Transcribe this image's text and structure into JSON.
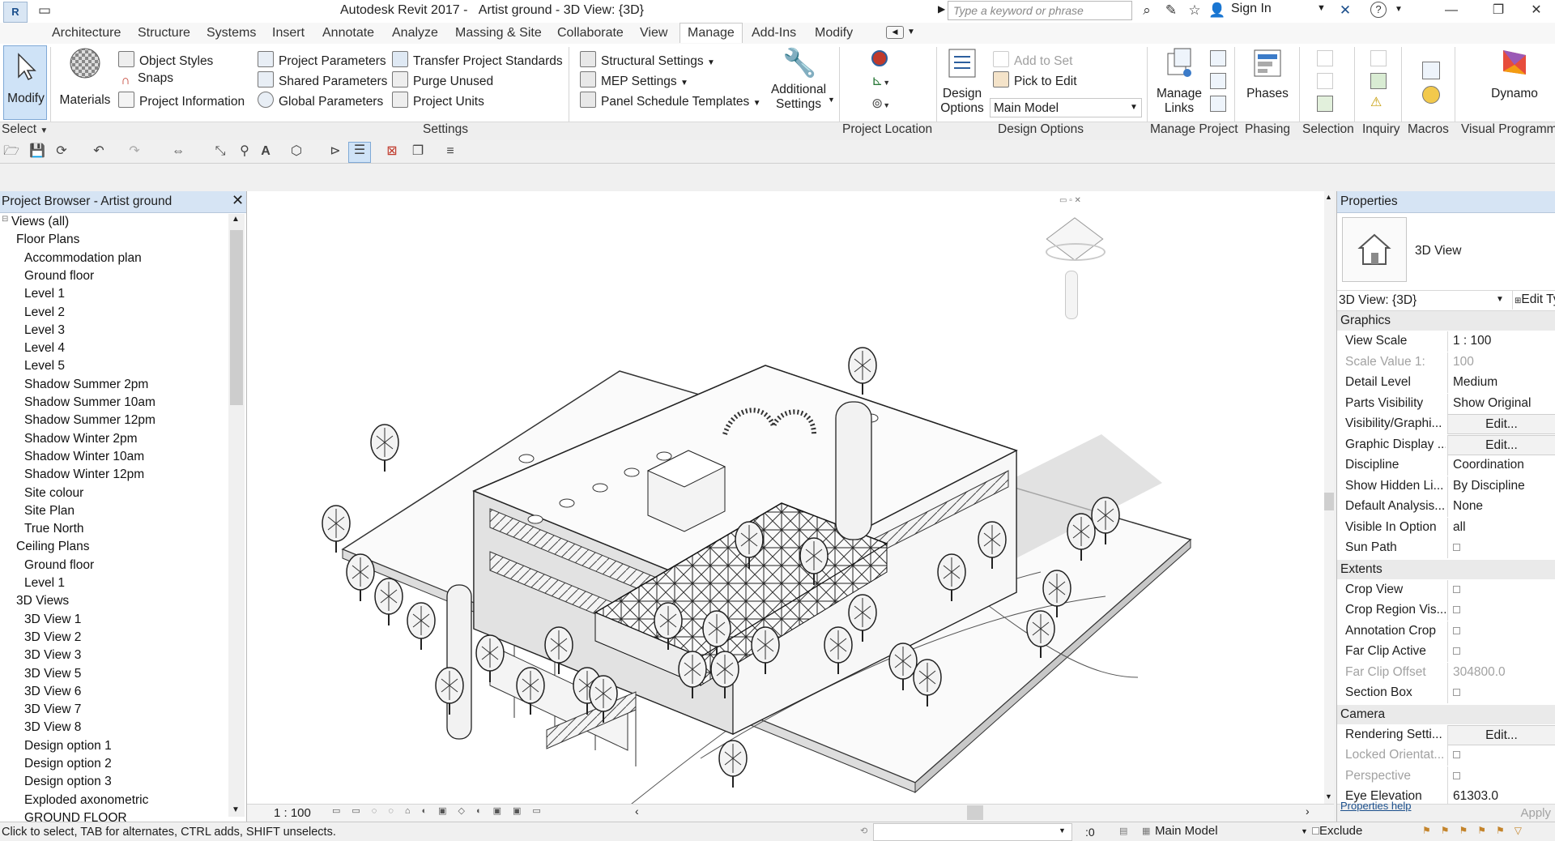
{
  "titlebar": {
    "app_logo": "R",
    "app_title": "Autodesk Revit 2017 -",
    "document_title": "Artist ground - 3D View: {3D}",
    "search_placeholder": "Type a keyword or phrase",
    "sign_in": "Sign In"
  },
  "tabs": [
    "Architecture",
    "Structure",
    "Systems",
    "Insert",
    "Annotate",
    "Analyze",
    "Massing & Site",
    "Collaborate",
    "View",
    "Manage",
    "Add-Ins",
    "Modify"
  ],
  "active_tab": "Manage",
  "ribbon": {
    "modify": "Modify",
    "select": "Select",
    "materials": "Materials",
    "object_styles": "Object  Styles",
    "snaps": "Snaps",
    "project_information": "Project  Information",
    "project_parameters": "Project  Parameters",
    "shared_parameters": "Shared  Parameters",
    "global_parameters": "Global  Parameters",
    "transfer_project_standards": "Transfer  Project Standards",
    "purge_unused": "Purge  Unused",
    "project_units": "Project  Units",
    "structural_settings": "Structural  Settings",
    "mep_settings": "MEP  Settings",
    "panel_schedule_templates": "Panel Schedule  Templates",
    "additional_settings_1": "Additional",
    "additional_settings_2": "Settings",
    "design_options_1": "Design",
    "design_options_2": "Options",
    "add_to_set": "Add to Set",
    "pick_to_edit": "Pick to Edit",
    "main_model": "Main Model",
    "manage_links_1": "Manage",
    "manage_links_2": "Links",
    "phases": "Phases",
    "dynamo": "Dynamo",
    "panels": {
      "settings": "Settings",
      "project_location": "Project Location",
      "design_options": "Design Options",
      "manage_project": "Manage Project",
      "phasing": "Phasing",
      "selection": "Selection",
      "inquiry": "Inquiry",
      "macros": "Macros",
      "visual_programming": "Visual Programmi"
    }
  },
  "project_browser": {
    "title": "Project Browser - Artist ground",
    "root": "Views (all)",
    "floor_plans": "Floor Plans",
    "floor_plan_items": [
      "Accommodation plan",
      "Ground floor",
      "Level 1",
      "Level 2",
      "Level 3",
      "Level 4",
      "Level 5",
      "Shadow Summer 2pm",
      "Shadow Summer 10am",
      "Shadow Summer 12pm",
      "Shadow Winter 2pm",
      "Shadow Winter 10am",
      "Shadow Winter 12pm",
      "Site colour",
      "Site Plan",
      "True North"
    ],
    "ceiling_plans": "Ceiling Plans",
    "ceiling_plan_items": [
      "Ground floor",
      "Level 1"
    ],
    "views_3d": "3D Views",
    "views_3d_items": [
      "3D View 1",
      "3D View 2",
      "3D View 3",
      "3D View 5",
      "3D View 6",
      "3D View 7",
      "3D View 8",
      "Design option 1",
      "Design option 2",
      "Design option 3",
      "Exploded axonometric",
      "GROUND FLOOR"
    ]
  },
  "view": {
    "scale": "1 : 100"
  },
  "properties": {
    "title": "Properties",
    "type_name": "3D View",
    "instance_selector": "3D View: {3D}",
    "edit_type": "Edit Ty",
    "sections": {
      "graphics": "Graphics",
      "extents": "Extents",
      "camera": "Camera"
    },
    "graphics_rows": [
      {
        "k": "View Scale",
        "v": "1 : 100"
      },
      {
        "k": "Scale Value    1:",
        "v": "100"
      },
      {
        "k": "Detail Level",
        "v": "Medium"
      },
      {
        "k": "Parts Visibility",
        "v": "Show Original"
      },
      {
        "k": "Visibility/Graphi...",
        "v": "Edit..."
      },
      {
        "k": "Graphic Display ...",
        "v": "Edit..."
      },
      {
        "k": "Discipline",
        "v": "Coordination"
      },
      {
        "k": "Show Hidden Li...",
        "v": "By Discipline"
      },
      {
        "k": "Default Analysis...",
        "v": "None"
      },
      {
        "k": "Visible In Option",
        "v": "all"
      },
      {
        "k": "Sun Path",
        "v": ""
      }
    ],
    "extents_rows": [
      {
        "k": "Crop View",
        "v": ""
      },
      {
        "k": "Crop Region Vis...",
        "v": ""
      },
      {
        "k": "Annotation Crop",
        "v": ""
      },
      {
        "k": "Far Clip Active",
        "v": ""
      },
      {
        "k": "Far Clip Offset",
        "v": "304800.0"
      },
      {
        "k": "Section Box",
        "v": ""
      }
    ],
    "camera_rows": [
      {
        "k": "Rendering Setti...",
        "v": "Edit..."
      },
      {
        "k": "Locked Orientat...",
        "v": ""
      },
      {
        "k": "Perspective",
        "v": ""
      },
      {
        "k": "Eye Elevation",
        "v": "61303.0"
      }
    ],
    "help_link": "Properties help",
    "apply": "Apply"
  },
  "statusbar": {
    "hint": "Click to select, TAB for alternates, CTRL adds, SHIFT unselects.",
    "zero": ":0",
    "main_model": "Main Model",
    "exclude": "Exclude"
  },
  "colors": {
    "accent_blue": "#1b4f8c",
    "panel_header": "#d6e4f4"
  }
}
